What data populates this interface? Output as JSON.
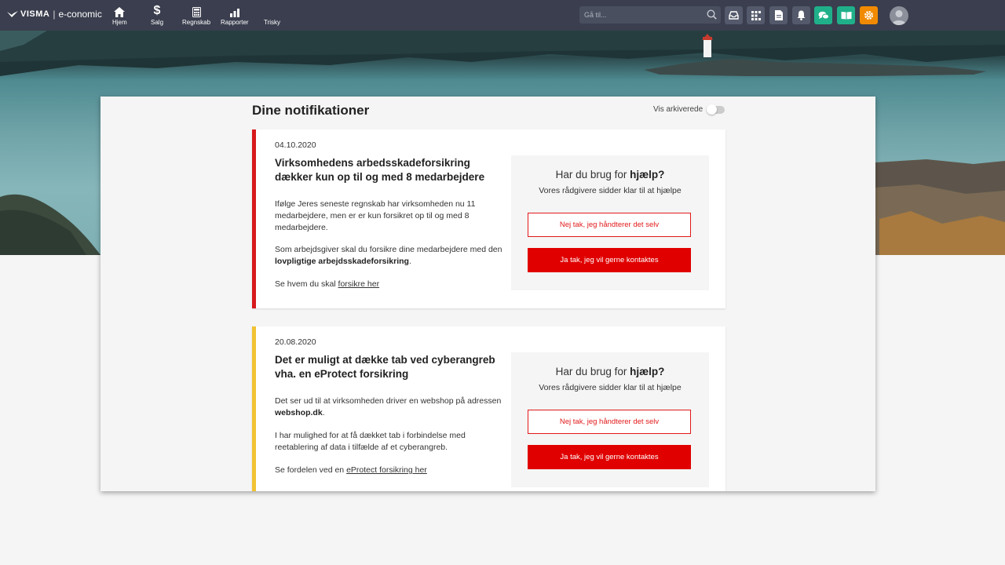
{
  "topbar": {
    "logo": {
      "brand": "VISMA",
      "product": "e-conomic"
    },
    "nav": [
      {
        "label": "Hjem",
        "icon": "home-icon"
      },
      {
        "label": "Salg",
        "icon": "dollar-icon"
      },
      {
        "label": "Regnskab",
        "icon": "calculator-icon"
      },
      {
        "label": "Rapporter",
        "icon": "bar-chart-icon"
      },
      {
        "label": "Trisky",
        "icon": ""
      }
    ],
    "search": {
      "placeholder": "Gå til..."
    },
    "icons": [
      "inbox-icon",
      "grid-icon",
      "document-icon",
      "bell-icon",
      "chat-icon",
      "book-icon",
      "gear-icon"
    ],
    "colors": {
      "bar": "#3a3e4e",
      "green": "#1fb08a",
      "orange": "#f18a00"
    }
  },
  "page": {
    "title": "Dine notifikationer",
    "archived_label": "Vis arkiverede",
    "archived_on": false
  },
  "help_box": {
    "question_prefix": "Har du brug for ",
    "question_bold": "hjælp?",
    "subtitle": "Vores rådgivere sidder klar til at hjælpe",
    "decline": "Nej tak, jeg håndterer det selv",
    "accept": "Ja tak, jeg vil gerne kontaktes"
  },
  "notifications": [
    {
      "date": "04.10.2020",
      "accent": "#d7191c",
      "heading": "Virksomhedens arbedsskadeforsikring dækker kun op til og med 8 medarbejdere",
      "p1": "Ifølge Jeres seneste regnskab har virksomheden nu 11 medarbejdere, men er er kun forsikret op til og med 8 medarbejdere.",
      "p2_before": "Som arbejdsgiver skal du forsikre dine medarbejdere med den ",
      "p2_bold": "lovpligtige arbejdsskadeforsikring",
      "p2_after": ".",
      "p3_before": "Se hvem du skal ",
      "p3_link": "forsikre her"
    },
    {
      "date": "20.08.2020",
      "accent": "#f1c232",
      "heading": "Det er muligt at dække tab ved cyberangreb vha. en eProtect forsikring",
      "p1_before": "Det ser ud til at virksomheden driver en webshop på adressen ",
      "p1_bold": "webshop.dk",
      "p1_after": ".",
      "p2": "I har mulighed for at få dækket tab i forbindelse med reetablering af data i tilfælde af et cyberangreb.",
      "p3_before": "Se fordelen ved en ",
      "p3_link": "eProtect forsikring her"
    }
  ]
}
